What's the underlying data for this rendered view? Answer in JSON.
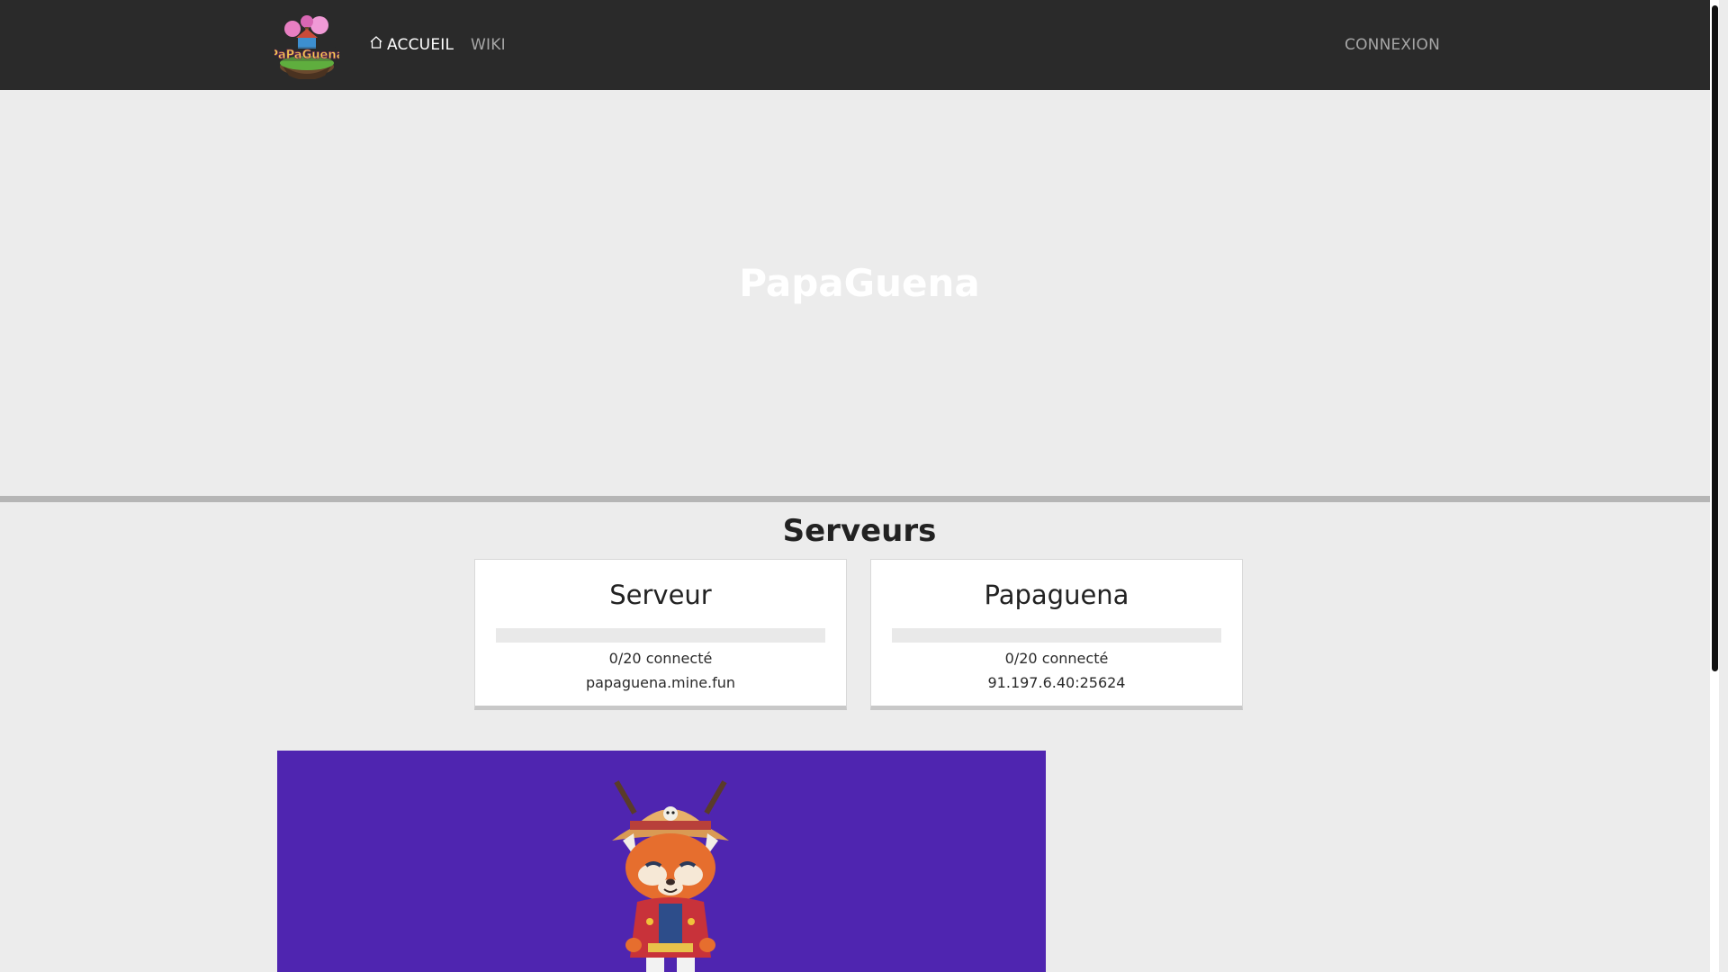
{
  "navbar": {
    "logo_alt": "PaPaGuena",
    "home_label": "ACCUEIL",
    "wiki_label": "WIKI",
    "login_label": "CONNEXION"
  },
  "hero": {
    "title": "PapaGuena"
  },
  "servers": {
    "title": "Serveurs",
    "cards": [
      {
        "name": "Serveur",
        "players": "0/20 connecté",
        "address": "papaguena.mine.fun",
        "fill_fraction": 0
      },
      {
        "name": "Papaguena",
        "players": "0/20 connecté",
        "address": "91.197.6.40:25624",
        "fill_fraction": 0
      }
    ]
  },
  "colors": {
    "navbar_bg": "#2a2a2a",
    "page_bg": "#ececec",
    "banner_bg": "#4f25b0",
    "active_nav": "#ffffff",
    "inactive_nav": "#a6a6a6"
  },
  "icons": {
    "home": "home-icon",
    "mascot": "red-panda-mascot"
  }
}
